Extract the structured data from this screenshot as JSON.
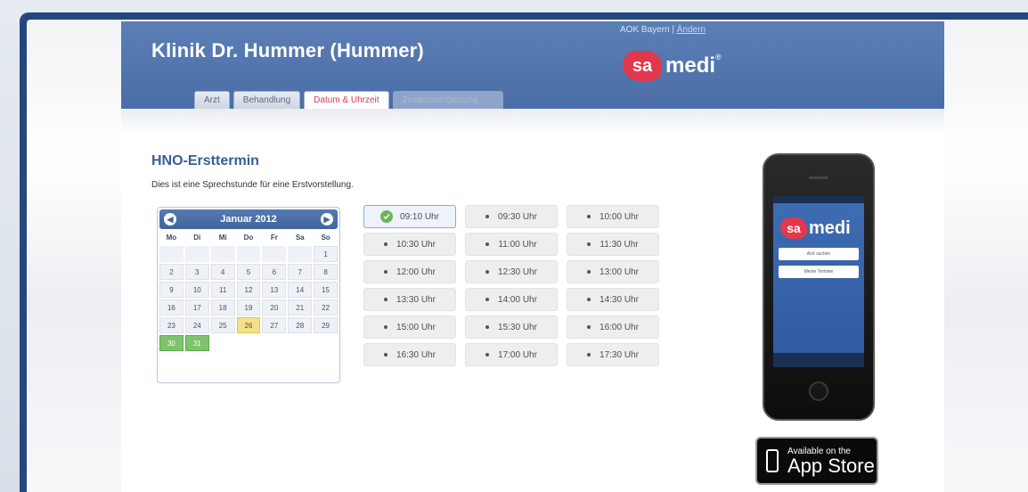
{
  "header": {
    "clinic_title": "Klinik Dr. Hummer (Hummer)",
    "insurer_name": "AOK Bayern",
    "insurer_sep": "|",
    "insurer_change": "Ändern",
    "logo_sa": "sa",
    "logo_medi": "medi",
    "logo_reg": "®"
  },
  "tabs": [
    {
      "label": "Arzt",
      "state": "normal"
    },
    {
      "label": "Behandlung",
      "state": "normal"
    },
    {
      "label": "Datum & Uhrzeit",
      "state": "active"
    },
    {
      "label": "Zusammenfassung",
      "state": "disabled"
    }
  ],
  "main": {
    "title": "HNO-Ersttermin",
    "description": "Dies ist eine Sprechstunde für eine Erstvorstellung."
  },
  "calendar": {
    "month_label": "Januar 2012",
    "prev_icon": "◀",
    "next_icon": "▶",
    "weekdays": [
      "Mo",
      "Di",
      "Mi",
      "Do",
      "Fr",
      "Sa",
      "So"
    ],
    "today": "26",
    "available_days": [
      "30",
      "31"
    ],
    "rows": [
      [
        "",
        "",
        "",
        "",
        "",
        "",
        "1"
      ],
      [
        "2",
        "3",
        "4",
        "5",
        "6",
        "7",
        "8"
      ],
      [
        "9",
        "10",
        "11",
        "12",
        "13",
        "14",
        "15"
      ],
      [
        "16",
        "17",
        "18",
        "19",
        "20",
        "21",
        "22"
      ],
      [
        "23",
        "24",
        "25",
        "26",
        "27",
        "28",
        "29"
      ],
      [
        "30",
        "31",
        "",
        "",
        "",
        "",
        ""
      ]
    ]
  },
  "slots": {
    "selected": "09:10 Uhr",
    "times": [
      "09:10 Uhr",
      "09:30 Uhr",
      "10:00 Uhr",
      "10:30 Uhr",
      "11:00 Uhr",
      "11:30 Uhr",
      "12:00 Uhr",
      "12:30 Uhr",
      "13:00 Uhr",
      "13:30 Uhr",
      "14:00 Uhr",
      "14:30 Uhr",
      "15:00 Uhr",
      "15:30 Uhr",
      "16:00 Uhr",
      "16:30 Uhr",
      "17:00 Uhr",
      "17:30 Uhr"
    ]
  },
  "phone": {
    "logo_sa": "sa",
    "logo_medi": "medi",
    "button_1": "Arzt suchen",
    "button_2": "Meine Termine"
  },
  "appstore": {
    "line1": "Available on the",
    "line2": "App Store"
  },
  "colors": {
    "frame": "#24487e",
    "header": "#4a6da6",
    "accent_red": "#e2384d",
    "title_blue": "#375d98",
    "today_yellow": "#f5e08a",
    "available_green": "#7dc46a"
  },
  "icons": {
    "selected_slot": "check-icon",
    "slot_marker": "bullet-icon",
    "phone_brand": "samedi-logo",
    "store": "smartphone-icon"
  }
}
